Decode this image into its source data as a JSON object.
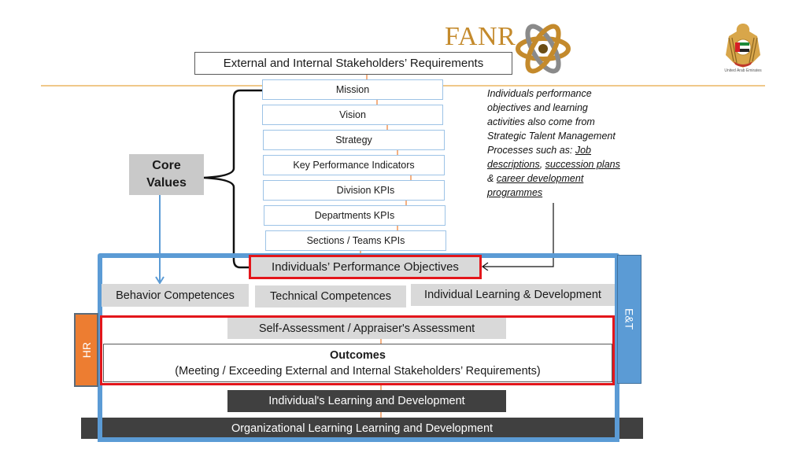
{
  "header": {
    "logo_text": "FANR",
    "emblem_caption": "United Arab Emirates",
    "stakeholders_box": "External and Internal Stakeholders’ Requirements"
  },
  "strategy_cascade": [
    {
      "label": "Mission"
    },
    {
      "label": "Vision"
    },
    {
      "label": "Strategy"
    },
    {
      "label": "Key Performance Indicators"
    },
    {
      "label": "Division KPIs"
    },
    {
      "label": "Departments KPIs"
    },
    {
      "label": "Sections  / Teams KPIs"
    }
  ],
  "core_values": {
    "line1": "Core",
    "line2": "Values"
  },
  "note": {
    "text_plain": "Individuals performance objectives and learning activities also come from Strategic Talent Management Processes such as: ",
    "link1": "Job descriptions",
    "sep1": ", ",
    "link2": "succession plans",
    "sep2": " & ",
    "link3": "career development programmes"
  },
  "individual_objectives": "Individuals’ Performance Objectives",
  "competences": {
    "behavior": "Behavior Competences",
    "technical": "Technical  Competences",
    "learning": "Individual Learning & Development"
  },
  "assessment": "Self-Assessment / Appraiser's Assessment",
  "outcomes": {
    "title": "Outcomes",
    "subtitle": "(Meeting / Exceeding External and Internal Stakeholders’ Requirements)"
  },
  "individual_learning": "Individual's Learning and Development",
  "organizational_learning": "Organizational Learning  Learning and Development",
  "side_labels": {
    "hr": "HR",
    "et": "E&T"
  },
  "colors": {
    "accent_blue": "#5b9bd5",
    "highlight_red": "#e3161b",
    "hr_orange": "#ed7d31",
    "brand_gold": "#c48a2c",
    "dark_bar": "#404040",
    "grey_box": "#d9d9d9"
  }
}
